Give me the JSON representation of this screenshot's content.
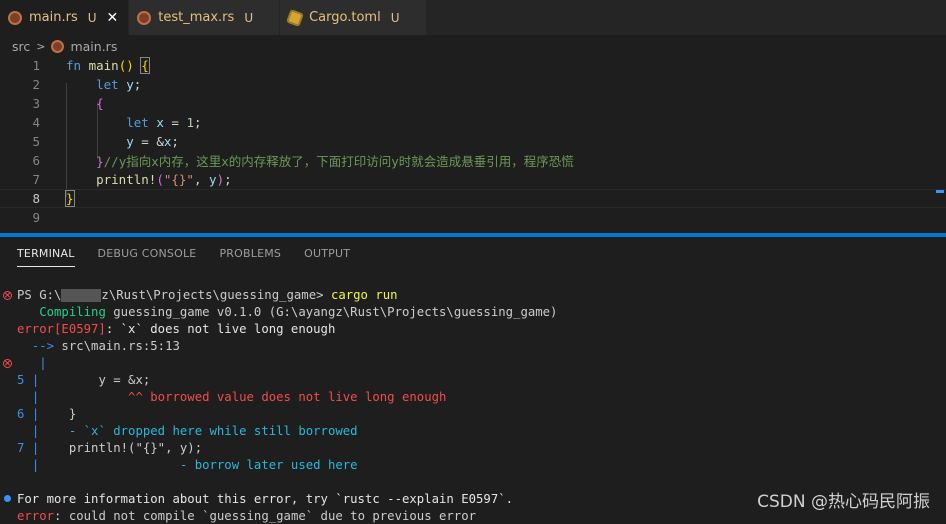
{
  "tabs": [
    {
      "label": "main.rs",
      "status": "U",
      "icon": "rust-file-icon",
      "active": true
    },
    {
      "label": "test_max.rs",
      "status": "U",
      "icon": "rust-file-icon",
      "active": false
    },
    {
      "label": "Cargo.toml",
      "status": "U",
      "icon": "toml-file-icon",
      "active": false
    }
  ],
  "breadcrumb": {
    "folder": "src",
    "file": "main.rs"
  },
  "editor": {
    "line_numbers": [
      "1",
      "2",
      "3",
      "4",
      "5",
      "6",
      "7",
      "8",
      "9"
    ],
    "comment": "//y指向x内存，这里x的内存释放了，下面打印访问y时就会造成悬垂引用，程序恐慌"
  },
  "panel": {
    "tabs": [
      "TERMINAL",
      "DEBUG CONSOLE",
      "PROBLEMS",
      "OUTPUT"
    ]
  },
  "terminal": {
    "prompt_prefix": "PS G:\\",
    "prompt_suffix": "z\\Rust\\Projects\\guessing_game> ",
    "command": "cargo run",
    "compiling_label": "Compiling",
    "compiling_rest": " guessing_game v0.1.0 (G:\\ayangz\\Rust\\Projects\\guessing_game)",
    "error_code": "error[E0597]",
    "error_msg": ": `x` does not live long enough",
    "arrow": "-->",
    "location": " src\\main.rs:5:13",
    "l5_num": "5",
    "l5_code": "        y = &x;",
    "l5_marker": "            ^^ borrowed value does not live long enough",
    "l6_num": "6",
    "l6_code": "    }",
    "l6_marker": "    - `x` dropped here while still borrowed",
    "l7_num": "7",
    "l7_code": "    println!(\"{}\", y);",
    "l7_marker": "                   - borrow later used here",
    "info_line": "For more information about this error, try `rustc --explain E0597`.",
    "final_error_label": "error",
    "final_error_msg": ": could not compile `guessing_game` due to previous error"
  },
  "watermark": "CSDN @热心码民阿振",
  "colors": {
    "accent": "#007acc",
    "error": "#f14c4c",
    "success": "#23d18b",
    "link": "#3b8eea"
  }
}
